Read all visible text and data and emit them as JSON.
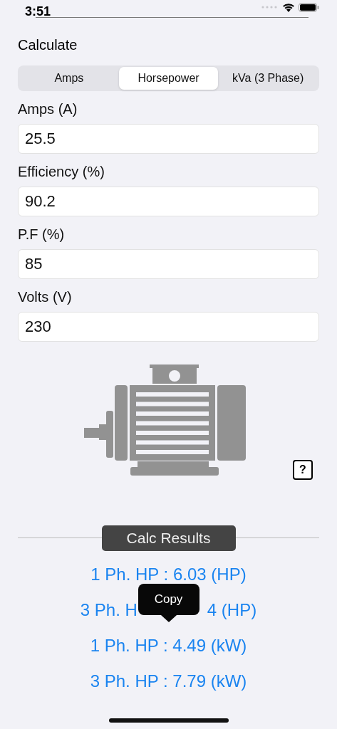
{
  "status_bar": {
    "time": "3:51"
  },
  "title": "Calculate",
  "tabs": [
    {
      "label": "Amps",
      "selected": false
    },
    {
      "label": "Horsepower",
      "selected": true
    },
    {
      "label": "kVa (3 Phase)",
      "selected": false
    }
  ],
  "fields": [
    {
      "label": "Amps (A)",
      "value": "25.5"
    },
    {
      "label": "Efficiency (%)",
      "value": "90.2"
    },
    {
      "label": "P.F (%)",
      "value": "85"
    },
    {
      "label": "Volts (V)",
      "value": "230"
    }
  ],
  "help_button": {
    "label": "?"
  },
  "results_header": "Calc Results",
  "results": [
    {
      "parts": [
        "1 Ph. HP : 6.03 (HP)"
      ]
    },
    {
      "parts": [
        "3 Ph. H",
        "4 (HP)"
      ]
    },
    {
      "parts": [
        "1 Ph. HP : 4.49 (kW)"
      ]
    },
    {
      "parts": [
        "3 Ph. HP : 7.79 (kW)"
      ]
    }
  ],
  "tooltip": {
    "label": "Copy"
  }
}
